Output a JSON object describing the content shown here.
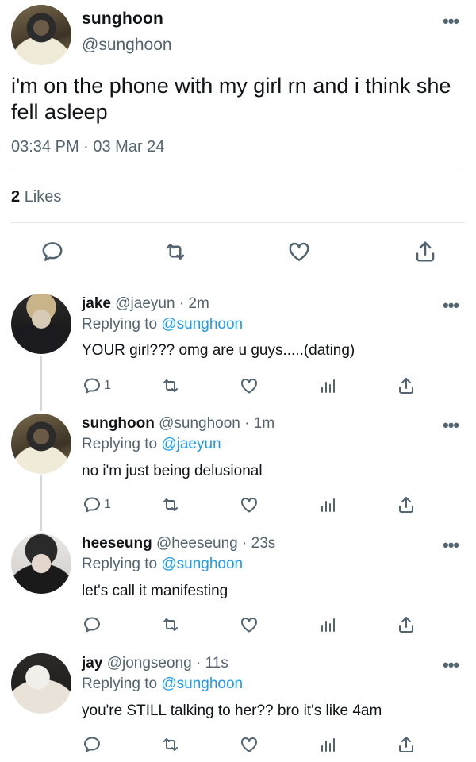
{
  "main_tweet": {
    "name": "sunghoon",
    "handle": "@sunghoon",
    "text": "i'm on the phone with my girl rn and i think she fell asleep",
    "timestamp": "03:34 PM · 03 Mar 24",
    "likes_count": "2",
    "likes_label": "Likes",
    "more_icon": "more-dots-icon"
  },
  "replies": [
    {
      "name": "jake",
      "handle": "@jaeyun",
      "time": "· 2m",
      "replying_label": "Replying to",
      "replying_to": "@sunghoon",
      "text": "YOUR girl??? omg are u guys.....(dating)",
      "reply_count": "1"
    },
    {
      "name": "sunghoon",
      "handle": "@sunghoon",
      "time": "· 1m",
      "replying_label": "Replying to",
      "replying_to": "@jaeyun",
      "text": "no i'm just being delusional",
      "reply_count": "1"
    },
    {
      "name": "heeseung",
      "handle": "@heeseung",
      "time": "· 23s",
      "replying_label": "Replying to",
      "replying_to": "@sunghoon",
      "text": "let's call it manifesting",
      "reply_count": ""
    },
    {
      "name": "jay",
      "handle": "@jongseong",
      "time": "· 11s",
      "replying_label": "Replying to",
      "replying_to": "@sunghoon",
      "text": "you're STILL talking to her?? bro it's like 4am",
      "reply_count": ""
    }
  ],
  "colors": {
    "text": "#0f1419",
    "secondary": "#536471",
    "link": "#1d9bf0",
    "divider": "#e6e9eb"
  }
}
